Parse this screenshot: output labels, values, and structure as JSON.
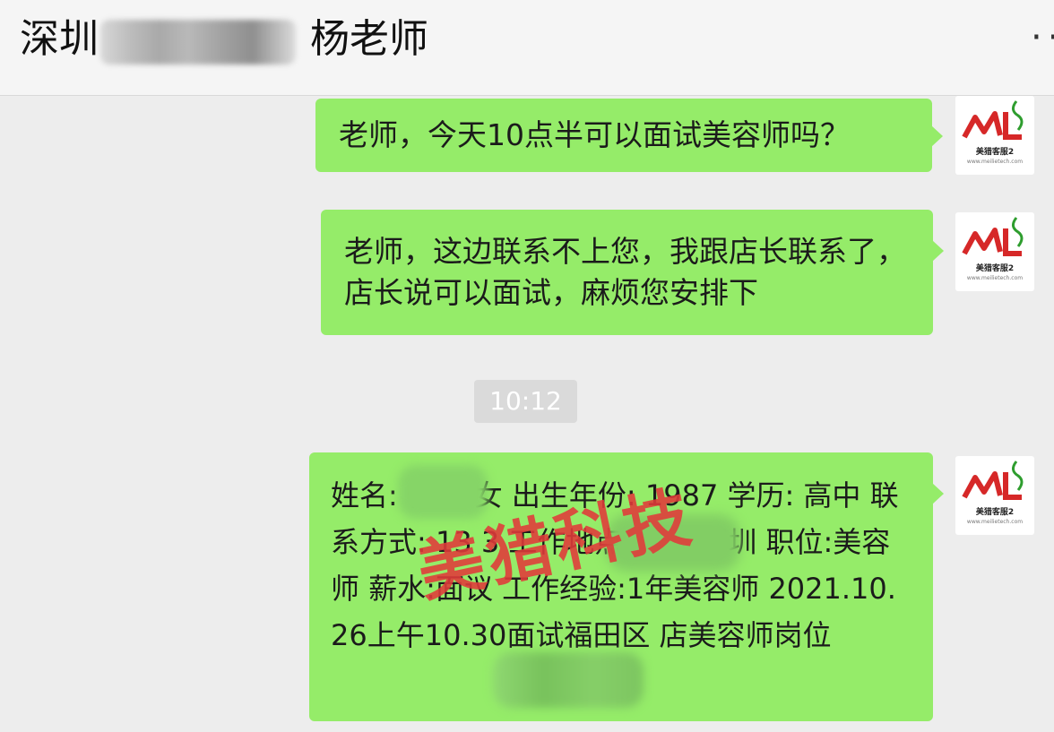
{
  "header": {
    "city": "深圳",
    "contact_name": "杨老师",
    "more_icon": "more-dots-icon"
  },
  "messages": [
    {
      "text": "老师，今天10点半可以面试美容师吗？"
    },
    {
      "text": "老师，这边联系不上您，我跟店长联系了，店长说可以面试，麻烦您安排下"
    },
    {
      "text": "姓名:      性别:女 出生年份: 1987 学历: 高中 联系方式: 13        3 工作地点:广东 深圳 职位:美容师 薪水:面议 工作经验:1年美容师 2021.10.26上午10.30面试福田区          店美容师岗位"
    }
  ],
  "timestamp": "10:12",
  "avatar": {
    "logo_text": "ML",
    "label": "美猎客服2",
    "sub": "www.meilietech.com"
  },
  "watermark": "美猎科技",
  "colors": {
    "bubble": "#95ec69",
    "background": "#ededed",
    "watermark": "#e23a3a"
  }
}
